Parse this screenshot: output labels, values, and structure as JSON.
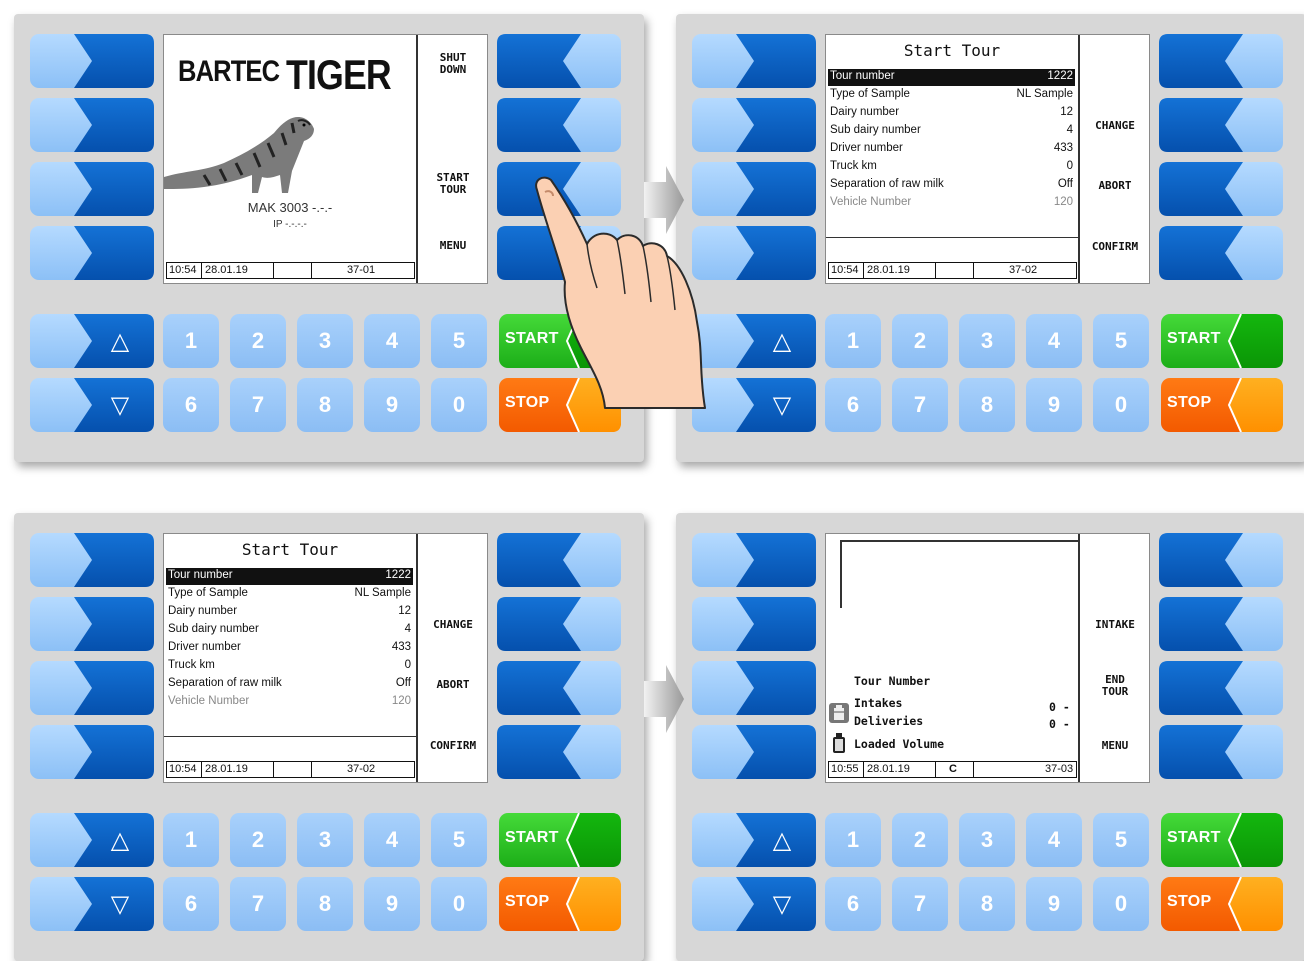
{
  "keypad": {
    "digits_top": [
      "1",
      "2",
      "3",
      "4",
      "5"
    ],
    "digits_bottom": [
      "6",
      "7",
      "8",
      "9",
      "0"
    ],
    "up_glyph": "△",
    "down_glyph": "▽",
    "start_label": "START",
    "stop_label": "STOP"
  },
  "panel1": {
    "logo_text_1": "BARTEC",
    "logo_text_2": "TIGER",
    "device_name": "MAK 3003 -.-.-",
    "ip_text": "IP -.-.-.-",
    "softkeys": [
      "SHUT\nDOWN",
      "START\nTOUR",
      "MENU"
    ],
    "status": {
      "time": "10:54",
      "date": "28.01.19",
      "code": "37-01"
    }
  },
  "start_tour": {
    "title": "Start Tour",
    "rows": [
      {
        "label": "Tour number",
        "value": "1222"
      },
      {
        "label": "Type of Sample",
        "value": "NL Sample"
      },
      {
        "label": "Dairy number",
        "value": "12"
      },
      {
        "label": "Sub dairy number",
        "value": "4"
      },
      {
        "label": "Driver number",
        "value": "433"
      },
      {
        "label": "Truck km",
        "value": "0"
      },
      {
        "label": "Separation of raw milk",
        "value": "Off"
      },
      {
        "label": "Vehicle Number",
        "value": "120"
      }
    ],
    "softkeys": [
      "CHANGE",
      "ABORT",
      "CONFIRM"
    ],
    "status": {
      "time": "10:54",
      "date": "28.01.19",
      "code": "37-02"
    }
  },
  "panel4": {
    "tour_number_label": "Tour Number",
    "intakes_label": "Intakes",
    "intakes_value": "0 -",
    "deliveries_label": "Deliveries",
    "deliveries_value": "0 -",
    "loaded_volume_label": "Loaded Volume",
    "softkeys": [
      "INTAKE",
      "END\nTOUR",
      "MENU"
    ],
    "status": {
      "time": "10:55",
      "date": "28.01.19",
      "mode": "C",
      "code": "37-03"
    }
  },
  "colors": {
    "key_light": "#9dcaf8",
    "key_dark": "#0a5fc3",
    "start_green": "#22c21f",
    "stop_orange": "#ff6a00",
    "stop_yellow": "#ffa000",
    "selection": "#111111"
  }
}
